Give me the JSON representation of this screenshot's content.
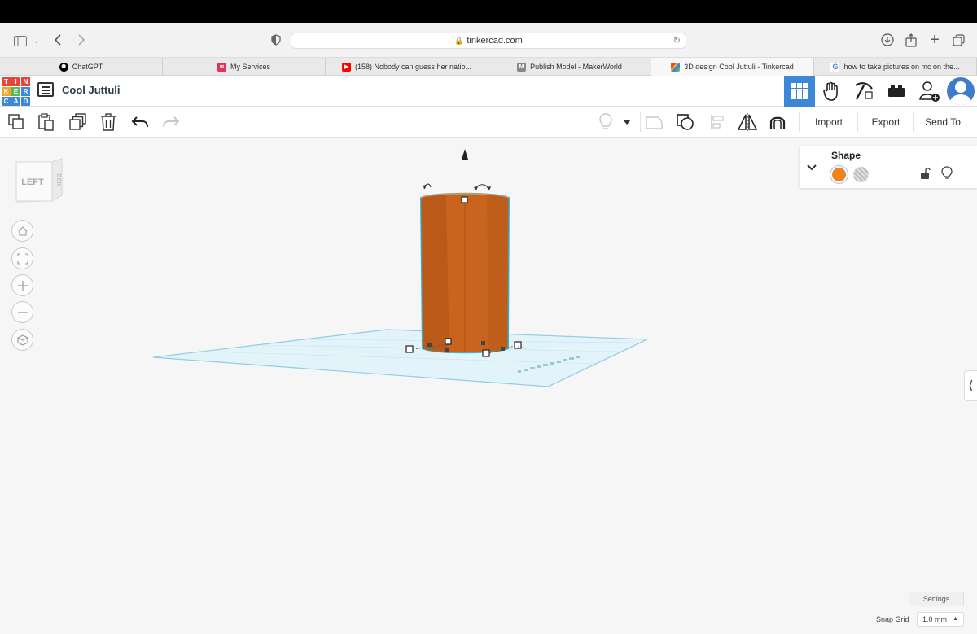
{
  "browser": {
    "url": "tinkercad.com",
    "tabs": [
      {
        "label": "ChatGPT",
        "icon": "chatgpt-icon",
        "color": "#000000"
      },
      {
        "label": "My Services",
        "icon": "services-icon",
        "color": "#e0335a"
      },
      {
        "label": "(158) Nobody can guess her natio...",
        "icon": "youtube-icon",
        "color": "#ff0000"
      },
      {
        "label": "Publish Model - MakerWorld",
        "icon": "makerworld-icon",
        "color": "#888888"
      },
      {
        "label": "3D design Cool Juttuli - Tinkercad",
        "icon": "tinkercad-icon",
        "color": "#3c87d6",
        "active": true
      },
      {
        "label": "how to take pictures on mc on the...",
        "icon": "google-icon",
        "color": "#4285f4"
      }
    ]
  },
  "app": {
    "logo_letters": [
      "T",
      "I",
      "N",
      "K",
      "E",
      "R",
      "C",
      "A",
      "D"
    ],
    "project_name": "Cool Juttuli"
  },
  "toolbar": {
    "import_label": "Import",
    "export_label": "Export",
    "send_to_label": "Send To"
  },
  "viewcube": {
    "face_label": "LEFT",
    "side_label": "BCK"
  },
  "shape_panel": {
    "title": "Shape",
    "solid_color": "#f0821e"
  },
  "workplane": {
    "object_color": "#c8641e",
    "selection_color": "#37b4d8"
  },
  "footer": {
    "settings_label": "Settings",
    "snap_grid_label": "Snap Grid",
    "snap_grid_value": "1.0 mm"
  }
}
